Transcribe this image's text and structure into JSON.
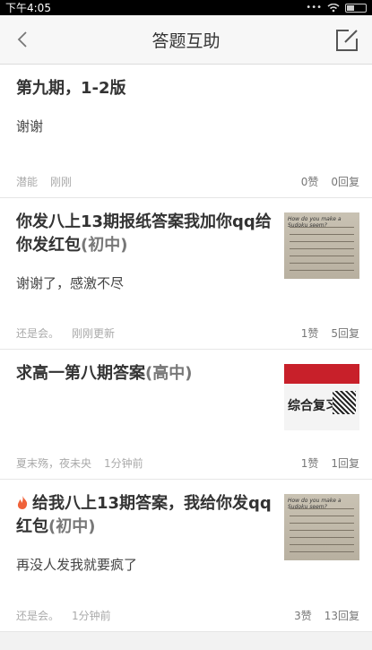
{
  "status": {
    "time": "下午4:05",
    "dots": "•••"
  },
  "header": {
    "title": "答题互助"
  },
  "posts": [
    {
      "title": "第九期，1-2版",
      "tag": "",
      "body": "谢谢",
      "author": "潜能",
      "time": "刚刚",
      "likes": "0赞",
      "replies": "0回复"
    },
    {
      "title": "你发八上13期报纸答案我加你qq给你发红包",
      "tag": "(初中)",
      "body": "谢谢了，感激不尽",
      "author": "还是会。",
      "time": "刚刚更新",
      "likes": "1赞",
      "replies": "5回复"
    },
    {
      "title": "求高一第八期答案",
      "tag": "(高中)",
      "body": "",
      "author": "夏末殇，夜未央",
      "time": "1分钟前",
      "likes": "1赞",
      "replies": "1回复",
      "thumb_text": "综合复习"
    },
    {
      "title": "给我八上13期答案，我给你发qq红包",
      "tag": "(初中)",
      "body": "再没人发我就要疯了",
      "author": "还是会。",
      "time": "1分钟前",
      "likes": "3赞",
      "replies": "13回复",
      "hot": true
    }
  ],
  "thumb_header": "How do you make a Sudoku seem?",
  "colors": {
    "fire": "#f0623a",
    "review_red": "#c8202a"
  }
}
